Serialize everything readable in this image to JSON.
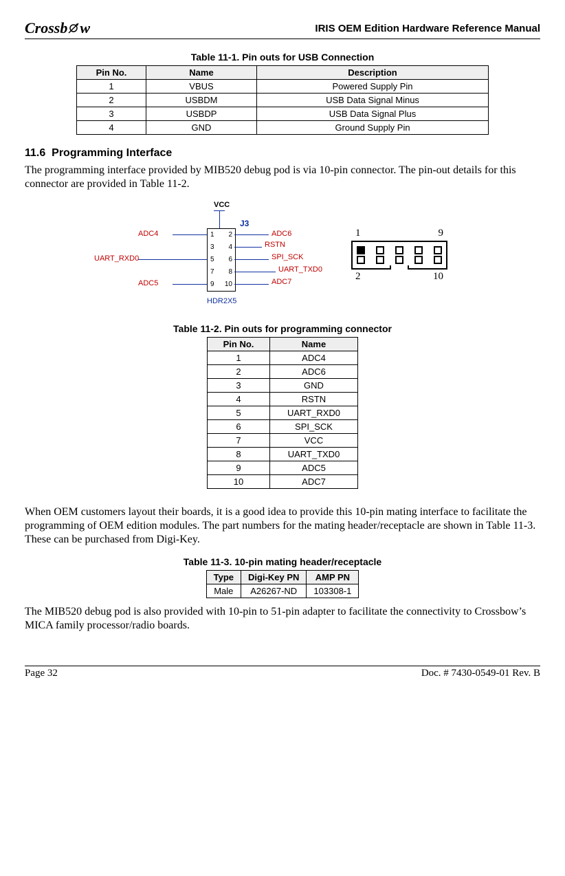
{
  "header": {
    "logo_text": "Crossb",
    "logo_text2": "w",
    "doc_title": "IRIS OEM Edition Hardware Reference Manual"
  },
  "table1": {
    "caption": "Table 11-1. Pin outs for USB Connection",
    "headers": [
      "Pin No.",
      "Name",
      "Description"
    ],
    "rows": [
      [
        "1",
        "VBUS",
        "Powered Supply Pin"
      ],
      [
        "2",
        "USBDM",
        "USB Data Signal Minus"
      ],
      [
        "3",
        "USBDP",
        "USB Data Signal Plus"
      ],
      [
        "4",
        "GND",
        "Ground Supply Pin"
      ]
    ]
  },
  "section": {
    "num": "11.6",
    "title": "Programming Interface"
  },
  "para1": "The programming interface provided by MIB520 debug pod is via 10-pin connector. The pin-out details for this connector are provided in Table 11-2.",
  "schematic": {
    "vcc": "VCC",
    "j3": "J3",
    "left": [
      "ADC4",
      "UART_RXD0",
      "ADC5"
    ],
    "right": [
      "ADC6",
      "RSTN",
      "SPI_SCK",
      "UART_TXD0",
      "ADC7"
    ],
    "pins_left": [
      "1",
      "3",
      "5",
      "7",
      "9"
    ],
    "pins_right": [
      "2",
      "4",
      "6",
      "8",
      "10"
    ],
    "footer": "HDR2X5"
  },
  "connector": {
    "tl": "1",
    "tr": "9",
    "bl": "2",
    "br": "10"
  },
  "table2": {
    "caption": "Table 11-2. Pin outs for programming connector",
    "headers": [
      "Pin No.",
      "Name"
    ],
    "rows": [
      [
        "1",
        "ADC4"
      ],
      [
        "2",
        "ADC6"
      ],
      [
        "3",
        "GND"
      ],
      [
        "4",
        "RSTN"
      ],
      [
        "5",
        "UART_RXD0"
      ],
      [
        "6",
        "SPI_SCK"
      ],
      [
        "7",
        "VCC"
      ],
      [
        "8",
        "UART_TXD0"
      ],
      [
        "9",
        "ADC5"
      ],
      [
        "10",
        "ADC7"
      ]
    ]
  },
  "para2": "When OEM customers layout their boards, it is a good idea to provide this 10-pin mating interface to facilitate the programming of OEM edition modules. The part numbers for the mating header/receptacle are shown in Table 11-3. These can be purchased from Digi-Key.",
  "table3": {
    "caption": "Table 11-3. 10-pin mating header/receptacle",
    "headers": [
      "Type",
      "Digi-Key PN",
      "AMP PN"
    ],
    "rows": [
      [
        "Male",
        "A26267-ND",
        "103308-1"
      ]
    ]
  },
  "para3": "The MIB520 debug pod is also provided with 10-pin to 51-pin adapter to facilitate the connectivity to Crossbow’s MICA family processor/radio boards.",
  "footer": {
    "page": "Page 32",
    "docnum": "Doc. # 7430-0549-01 Rev. B"
  }
}
